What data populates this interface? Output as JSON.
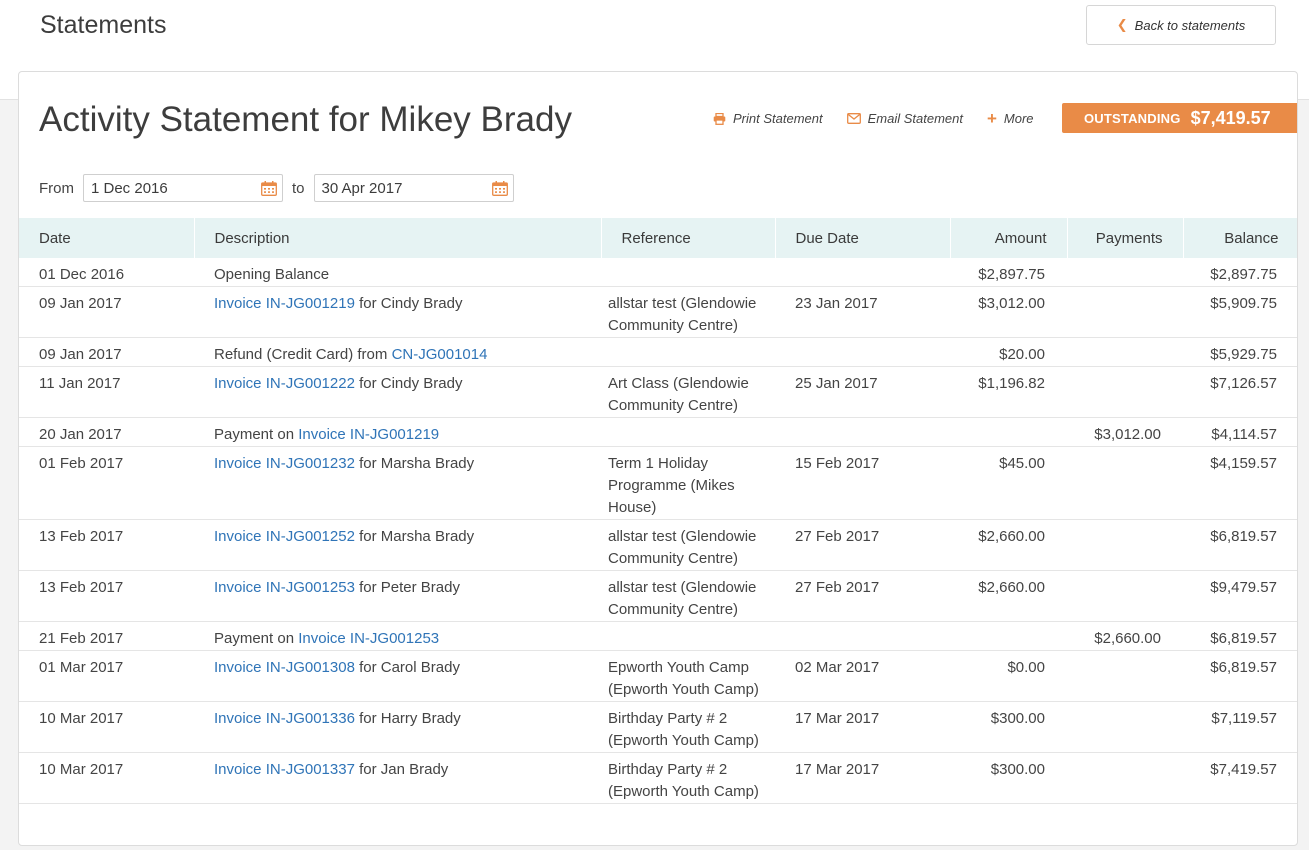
{
  "header": {
    "title": "Statements",
    "back_label": "Back to statements"
  },
  "statement": {
    "title": "Activity Statement for Mikey Brady",
    "actions": {
      "print": "Print Statement",
      "email": "Email Statement",
      "more": "More"
    },
    "outstanding_label": "OUTSTANDING",
    "outstanding_value": "$7,419.57",
    "accent_color": "#e98b47",
    "link_color": "#2f74b7",
    "header_row_color": "#e6f3f3"
  },
  "filters": {
    "from_label": "From",
    "from_value": "1 Dec 2016",
    "to_label": "to",
    "to_value": "30 Apr 2017"
  },
  "table": {
    "columns": [
      "Date",
      "Description",
      "Reference",
      "Due Date",
      "Amount",
      "Payments",
      "Balance"
    ],
    "rows": [
      {
        "date": "01 Dec 2016",
        "desc_pre": "Opening Balance",
        "link": "",
        "desc_post": "",
        "ref": "",
        "due": "",
        "amount": "$2,897.75",
        "payments": "",
        "balance": "$2,897.75"
      },
      {
        "date": "09 Jan 2017",
        "desc_pre": "",
        "link": "Invoice IN-JG001219",
        "desc_post": " for Cindy Brady",
        "ref": "allstar test (Glendowie Community Centre)",
        "due": "23 Jan 2017",
        "amount": "$3,012.00",
        "payments": "",
        "balance": "$5,909.75"
      },
      {
        "date": "09 Jan 2017",
        "desc_pre": "Refund (Credit Card) from ",
        "link": "CN-JG001014",
        "desc_post": "",
        "ref": "",
        "due": "",
        "amount": "$20.00",
        "payments": "",
        "balance": "$5,929.75"
      },
      {
        "date": "11 Jan 2017",
        "desc_pre": "",
        "link": "Invoice IN-JG001222",
        "desc_post": " for Cindy Brady",
        "ref": "Art Class (Glendowie Community Centre)",
        "due": "25 Jan 2017",
        "amount": "$1,196.82",
        "payments": "",
        "balance": "$7,126.57"
      },
      {
        "date": "20 Jan 2017",
        "desc_pre": "Payment on ",
        "link": "Invoice IN-JG001219",
        "desc_post": "",
        "ref": "",
        "due": "",
        "amount": "",
        "payments": "$3,012.00",
        "balance": "$4,114.57"
      },
      {
        "date": "01 Feb 2017",
        "desc_pre": "",
        "link": "Invoice IN-JG001232",
        "desc_post": " for Marsha Brady",
        "ref": "Term 1 Holiday Programme (Mikes House)",
        "due": "15 Feb 2017",
        "amount": "$45.00",
        "payments": "",
        "balance": "$4,159.57"
      },
      {
        "date": "13 Feb 2017",
        "desc_pre": "",
        "link": "Invoice IN-JG001252",
        "desc_post": " for Marsha Brady",
        "ref": "allstar test (Glendowie Community Centre)",
        "due": "27 Feb 2017",
        "amount": "$2,660.00",
        "payments": "",
        "balance": "$6,819.57"
      },
      {
        "date": "13 Feb 2017",
        "desc_pre": "",
        "link": "Invoice IN-JG001253",
        "desc_post": " for Peter Brady",
        "ref": "allstar test (Glendowie Community Centre)",
        "due": "27 Feb 2017",
        "amount": "$2,660.00",
        "payments": "",
        "balance": "$9,479.57"
      },
      {
        "date": "21 Feb 2017",
        "desc_pre": "Payment on ",
        "link": "Invoice IN-JG001253",
        "desc_post": "",
        "ref": "",
        "due": "",
        "amount": "",
        "payments": "$2,660.00",
        "balance": "$6,819.57"
      },
      {
        "date": "01 Mar 2017",
        "desc_pre": "",
        "link": "Invoice IN-JG001308",
        "desc_post": " for Carol Brady",
        "ref": "Epworth Youth Camp (Epworth Youth Camp)",
        "due": "02 Mar 2017",
        "amount": "$0.00",
        "payments": "",
        "balance": "$6,819.57"
      },
      {
        "date": "10 Mar 2017",
        "desc_pre": "",
        "link": "Invoice IN-JG001336",
        "desc_post": " for Harry Brady",
        "ref": "Birthday Party # 2 (Epworth Youth Camp)",
        "due": "17 Mar 2017",
        "amount": "$300.00",
        "payments": "",
        "balance": "$7,119.57"
      },
      {
        "date": "10 Mar 2017",
        "desc_pre": "",
        "link": "Invoice IN-JG001337",
        "desc_post": " for Jan Brady",
        "ref": "Birthday Party # 2 (Epworth Youth Camp)",
        "due": "17 Mar 2017",
        "amount": "$300.00",
        "payments": "",
        "balance": "$7,419.57"
      }
    ]
  }
}
